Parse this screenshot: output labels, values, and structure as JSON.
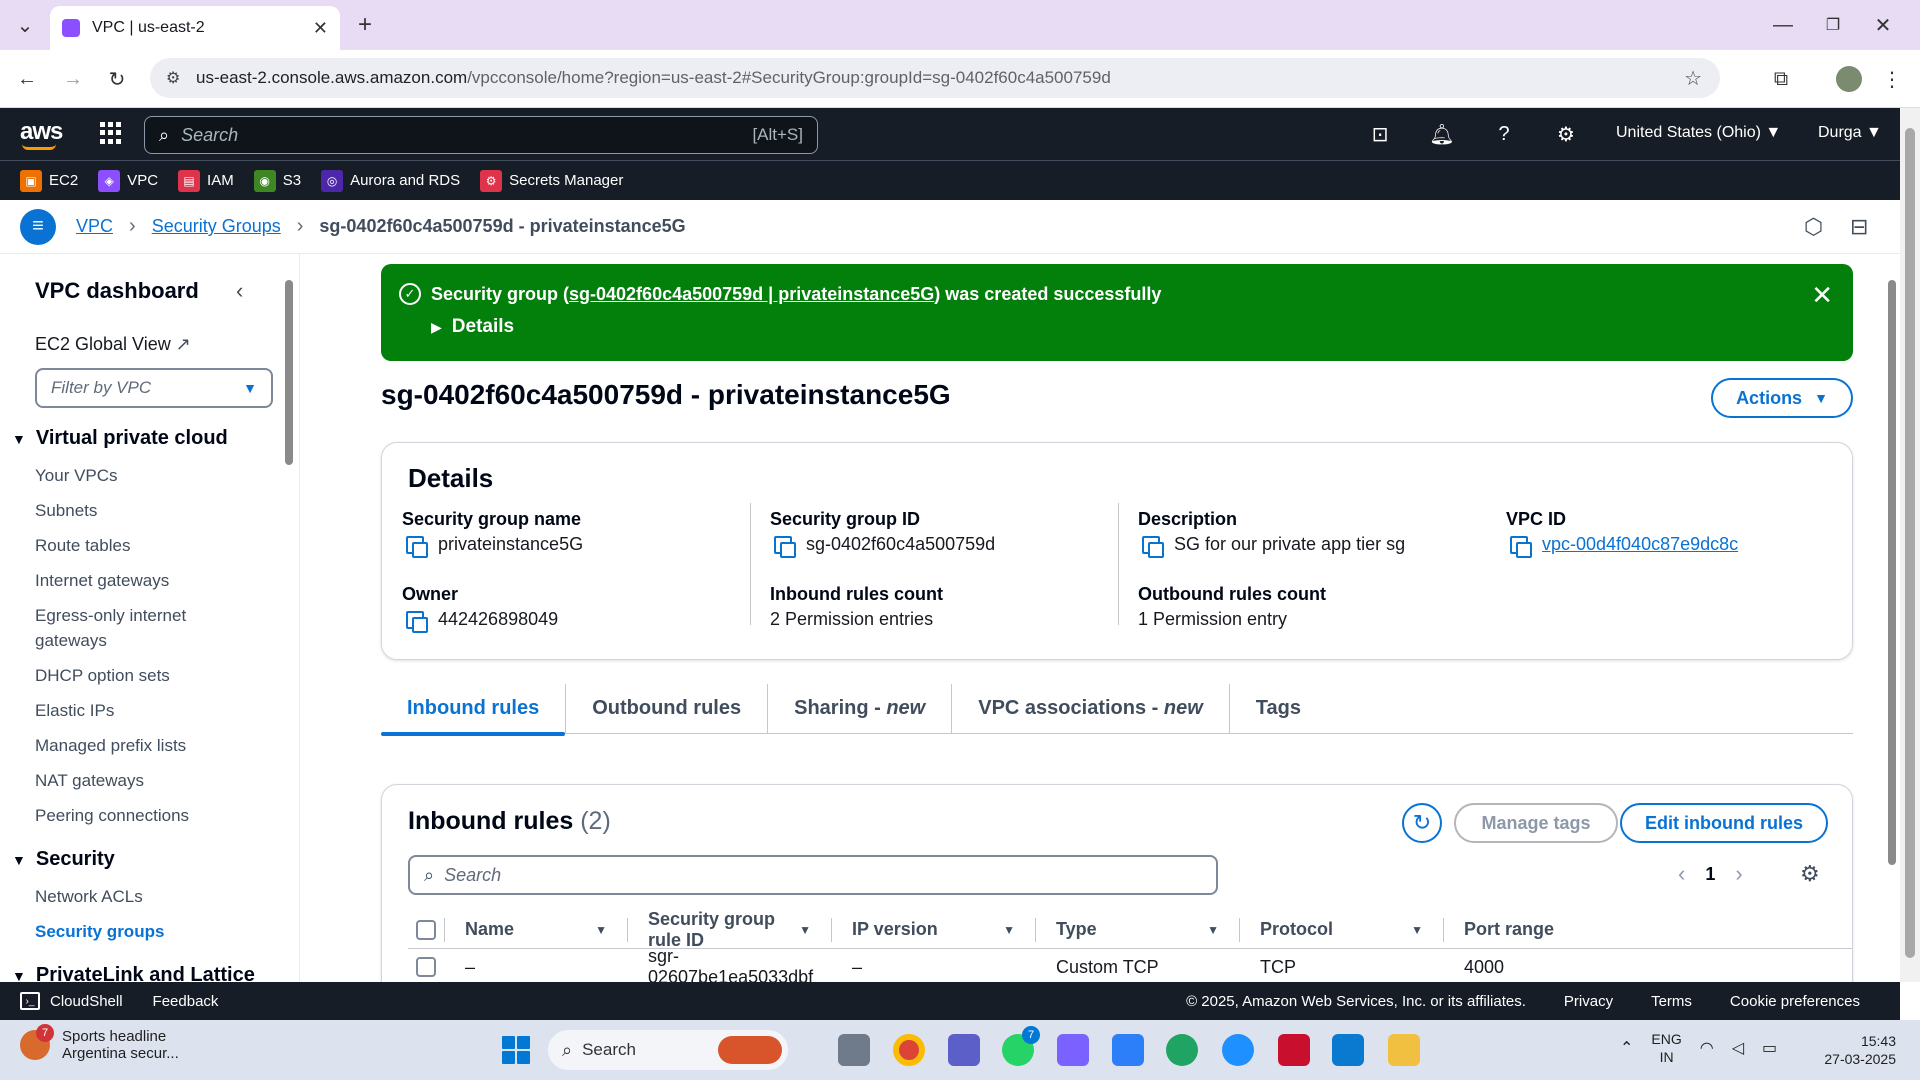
{
  "browser": {
    "tab_title": "VPC | us-east-2",
    "url_host": "us-east-2.console.aws.amazon.com",
    "url_rest": "/vpcconsole/home?region=us-east-2#SecurityGroup:groupId=sg-0402f60c4a500759d"
  },
  "topnav": {
    "logo": "aws",
    "search_placeholder": "Search",
    "search_shortcut": "[Alt+S]",
    "region": "United States (Ohio) ▼",
    "user": "Durga ▼"
  },
  "favorites": [
    {
      "label": "EC2",
      "color": "#ed7100"
    },
    {
      "label": "VPC",
      "color": "#8c4fff"
    },
    {
      "label": "IAM",
      "color": "#dd344c"
    },
    {
      "label": "S3",
      "color": "#3f8624"
    },
    {
      "label": "Aurora and RDS",
      "color": "#4d27aa"
    },
    {
      "label": "Secrets Manager",
      "color": "#dd344c"
    }
  ],
  "breadcrumb": {
    "vpc": "VPC",
    "security_groups": "Security Groups",
    "current": "sg-0402f60c4a500759d - privateinstance5G"
  },
  "sidebar": {
    "title": "VPC dashboard",
    "ec2_global": "EC2 Global View",
    "filter_placeholder": "Filter by VPC",
    "sec_vpc": "Virtual private cloud",
    "items_vpc": [
      "Your VPCs",
      "Subnets",
      "Route tables",
      "Internet gateways",
      "Egress-only internet",
      "gateways",
      "DHCP option sets",
      "Elastic IPs",
      "Managed prefix lists",
      "NAT gateways",
      "Peering connections"
    ],
    "sec_security": "Security",
    "items_security": [
      "Network ACLs",
      "Security groups"
    ],
    "sec_privatelink": "PrivateLink and Lattice"
  },
  "flash": {
    "prefix": "Security group (",
    "link": "sg-0402f60c4a500759d | privateinstance5G",
    "suffix": ") was created successfully",
    "details": "Details"
  },
  "page": {
    "title": "sg-0402f60c4a500759d - privateinstance5G",
    "actions": "Actions"
  },
  "details": {
    "heading": "Details",
    "sg_name_label": "Security group name",
    "sg_name": "privateinstance5G",
    "sg_id_label": "Security group ID",
    "sg_id": "sg-0402f60c4a500759d",
    "desc_label": "Description",
    "desc": "SG for our private app tier sg",
    "vpc_id_label": "VPC ID",
    "vpc_id": "vpc-00d4f040c87e9dc8c",
    "owner_label": "Owner",
    "owner": "442426898049",
    "inbound_count_label": "Inbound rules count",
    "inbound_count": "2 Permission entries",
    "outbound_count_label": "Outbound rules count",
    "outbound_count": "1 Permission entry"
  },
  "tabs": {
    "inbound": "Inbound rules",
    "outbound": "Outbound rules",
    "sharing": "Sharing - ",
    "sharing_new": "new",
    "vpc_assoc": "VPC associations - ",
    "vpc_assoc_new": "new",
    "tags": "Tags"
  },
  "rules": {
    "title": "Inbound rules",
    "count": "(2)",
    "manage_tags": "Manage tags",
    "edit": "Edit inbound rules",
    "search_placeholder": "Search",
    "page": "1",
    "columns": [
      "Name",
      "Security group rule ID",
      "IP version",
      "Type",
      "Protocol",
      "Port range"
    ],
    "row": {
      "name": "–",
      "rule_id": "sgr-02607be1ea5033dbf",
      "ip_version": "–",
      "type": "Custom TCP",
      "protocol": "TCP",
      "port_range": "4000"
    }
  },
  "footer": {
    "cloudshell": "CloudShell",
    "feedback": "Feedback",
    "copyright": "© 2025, Amazon Web Services, Inc. or its affiliates.",
    "privacy": "Privacy",
    "terms": "Terms",
    "cookies": "Cookie preferences"
  },
  "taskbar": {
    "weather_title": "Sports headline",
    "weather_sub": "Argentina secur...",
    "weather_badge": "7",
    "search": "Search",
    "whatsapp_badge": "7",
    "lang1": "ENG",
    "lang2": "IN",
    "time": "15:43",
    "date": "27-03-2025"
  }
}
